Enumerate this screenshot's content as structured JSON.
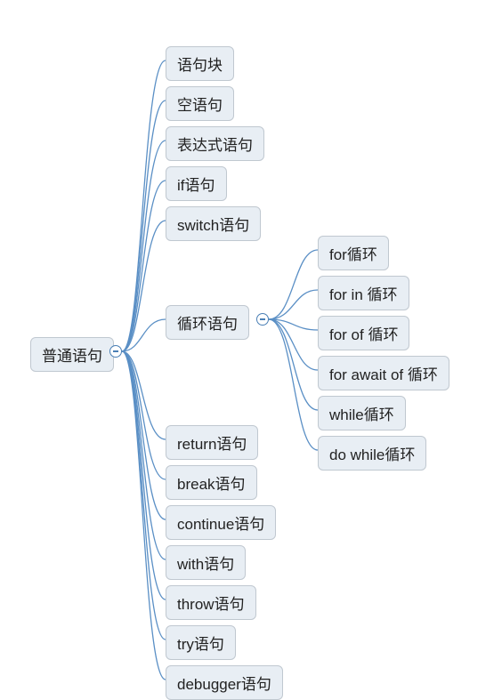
{
  "root": {
    "label": "普通语句"
  },
  "level1": [
    {
      "id": "stmt-block",
      "label": "语句块"
    },
    {
      "id": "empty-stmt",
      "label": "空语句"
    },
    {
      "id": "expr-stmt",
      "label": "表达式语句"
    },
    {
      "id": "if-stmt",
      "label": "if语句"
    },
    {
      "id": "switch-stmt",
      "label": "switch语句"
    },
    {
      "id": "loop-stmt",
      "label": "循环语句",
      "hasChildren": true
    },
    {
      "id": "return-stmt",
      "label": "return语句"
    },
    {
      "id": "break-stmt",
      "label": "break语句"
    },
    {
      "id": "continue-stmt",
      "label": "continue语句"
    },
    {
      "id": "with-stmt",
      "label": "with语句"
    },
    {
      "id": "throw-stmt",
      "label": "throw语句"
    },
    {
      "id": "try-stmt",
      "label": "try语句"
    },
    {
      "id": "debugger-stmt",
      "label": "debugger语句"
    }
  ],
  "loop_children": [
    {
      "id": "for-loop",
      "label": "for循环"
    },
    {
      "id": "for-in-loop",
      "label": "for in 循环"
    },
    {
      "id": "for-of-loop",
      "label": "for of 循环"
    },
    {
      "id": "for-await-of-loop",
      "label": "for await of 循环"
    },
    {
      "id": "while-loop",
      "label": "while循环"
    },
    {
      "id": "do-while-loop",
      "label": "do while循环"
    }
  ],
  "chart_data": {
    "type": "tree",
    "title": "",
    "root": {
      "name": "普通语句",
      "children": [
        {
          "name": "语句块"
        },
        {
          "name": "空语句"
        },
        {
          "name": "表达式语句"
        },
        {
          "name": "if语句"
        },
        {
          "name": "switch语句"
        },
        {
          "name": "循环语句",
          "children": [
            {
              "name": "for循环"
            },
            {
              "name": "for in 循环"
            },
            {
              "name": "for of 循环"
            },
            {
              "name": "for await of 循环"
            },
            {
              "name": "while循环"
            },
            {
              "name": "do while循环"
            }
          ]
        },
        {
          "name": "return语句"
        },
        {
          "name": "break语句"
        },
        {
          "name": "continue语句"
        },
        {
          "name": "with语句"
        },
        {
          "name": "throw语句"
        },
        {
          "name": "try语句"
        },
        {
          "name": "debugger语句"
        }
      ]
    }
  }
}
